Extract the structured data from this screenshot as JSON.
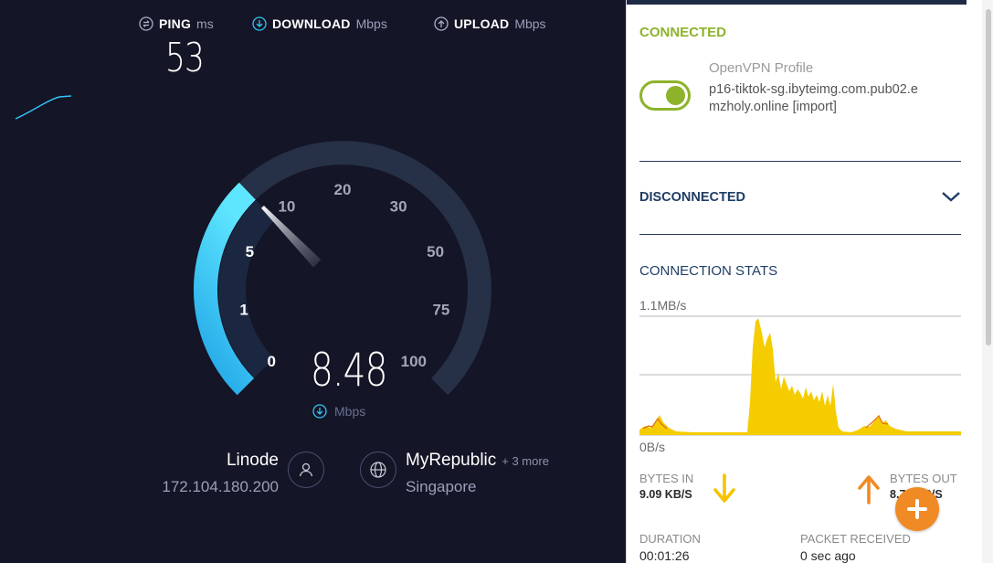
{
  "speedtest": {
    "metrics": {
      "ping": {
        "name": "PING",
        "unit": "ms",
        "icon": "ping-icon"
      },
      "download": {
        "name": "DOWNLOAD",
        "unit": "Mbps",
        "icon": "download-arrow-icon"
      },
      "upload": {
        "name": "UPLOAD",
        "unit": "Mbps",
        "icon": "upload-arrow-icon"
      }
    },
    "ping_value": "53",
    "gauge": {
      "ticks": [
        "0",
        "1",
        "5",
        "10",
        "20",
        "30",
        "50",
        "75",
        "100"
      ],
      "value": 8.48
    },
    "speed_value": "8.48",
    "speed_unit": "Mbps",
    "server": {
      "name": "Linode",
      "ip": "172.104.180.200",
      "icon": "user-icon"
    },
    "isp": {
      "name": "MyRepublic",
      "more": "+ 3 more",
      "location": "Singapore",
      "icon": "globe-icon"
    },
    "colors": {
      "background": "#141526",
      "accent": "#33c4f5",
      "track": "#263046"
    }
  },
  "vpn": {
    "status": "CONNECTED",
    "profile_caption": "OpenVPN Profile",
    "profile_name": "p16-tiktok-sg.ibyteimg.com.pub02.emzholy.online [import]",
    "toggle_on": true,
    "disconnected_label": "DISCONNECTED",
    "stats_title": "CONNECTION STATS",
    "chart_top_label": "1.1MB/s",
    "chart_bottom_label": "0B/s",
    "bytes_in_label": "BYTES IN",
    "bytes_in_value": "9.09 KB/S",
    "bytes_out_label": "BYTES OUT",
    "bytes_out_value": "8.71 KB/S",
    "duration_label": "DURATION",
    "duration_value": "00:01:26",
    "packet_label": "PACKET RECEIVED",
    "packet_value": "0 sec ago",
    "colors": {
      "connected": "#8db32a",
      "heading": "#1f3d66",
      "in_arrow": "#f5c400",
      "out_arrow": "#f08a24",
      "traffic": "#f5cc00"
    }
  }
}
